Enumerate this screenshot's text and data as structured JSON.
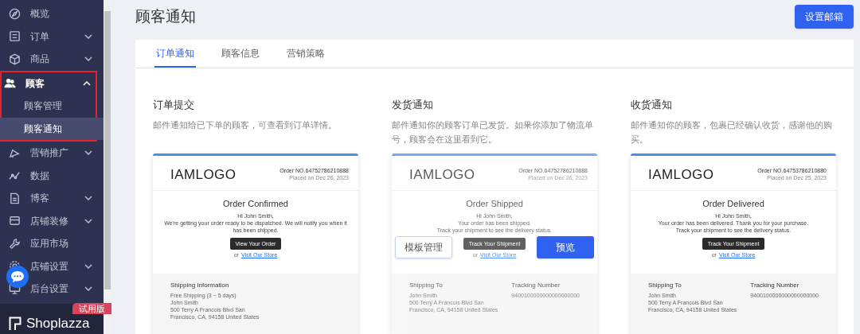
{
  "sidebar": {
    "items": [
      {
        "label": "概览",
        "expanded": false,
        "has_children": false,
        "highlighted": false
      },
      {
        "label": "订单",
        "expanded": false,
        "has_children": true,
        "highlighted": false
      },
      {
        "label": "商品",
        "expanded": false,
        "has_children": true,
        "highlighted": false
      },
      {
        "label": "顾客",
        "expanded": true,
        "has_children": true,
        "highlighted": true,
        "children": [
          {
            "label": "顾客管理",
            "selected": false
          },
          {
            "label": "顾客通知",
            "selected": true
          }
        ]
      },
      {
        "label": "营销推广",
        "expanded": false,
        "has_children": true,
        "highlighted": false
      },
      {
        "label": "数据",
        "expanded": false,
        "has_children": false,
        "highlighted": false
      },
      {
        "label": "博客",
        "expanded": false,
        "has_children": true,
        "highlighted": false
      },
      {
        "label": "店铺装修",
        "expanded": false,
        "has_children": true,
        "highlighted": false
      },
      {
        "label": "应用市场",
        "expanded": false,
        "has_children": false,
        "highlighted": false
      },
      {
        "label": "店铺设置",
        "expanded": false,
        "has_children": true,
        "highlighted": false
      },
      {
        "label": "后台设置",
        "expanded": false,
        "has_children": true,
        "highlighted": false
      }
    ],
    "trial_badge": "试用版",
    "brand": "Shoplazza"
  },
  "page": {
    "title": "顾客通知",
    "action_button": "设置邮箱"
  },
  "tabs": [
    {
      "label": "订单通知",
      "selected": true
    },
    {
      "label": "顾客信息",
      "selected": false
    },
    {
      "label": "营销策略",
      "selected": false
    }
  ],
  "notifications": [
    {
      "title": "订单提交",
      "description": "邮件通知给已下单的顾客，可查看到订单详情。",
      "hovered": false,
      "email": {
        "logo": "IAMLOGO",
        "order_no": "Order NO.64752786210888",
        "placed_on": "Placed on Dec 26, 2023",
        "heading": "Order Confirmed",
        "lines": [
          "Hi  John Smith,",
          "We're getting your order ready to be dispatched. We will notify you when it has been shipped."
        ],
        "button": "View Your Order",
        "or": "or",
        "link": "Visit Our Store",
        "footer": [
          {
            "heading": "Shipping Information",
            "lines": [
              "Free Shipping (3 ~ 5 days)",
              "John Smith",
              "500 Terry A Francois Blvd San",
              "Francisco, CA, 94158 United States"
            ]
          }
        ]
      }
    },
    {
      "title": "发货通知",
      "description": "邮件通知你的顾客订单已发货。如果你添加了物流单号，顾客会在这里看到它。",
      "hovered": true,
      "hover_buttons": [
        "模板管理",
        "预览"
      ],
      "email": {
        "logo": "IAMLOGO",
        "order_no": "Order NO.64752786210888",
        "placed_on": "Placed on Dec 26, 2023",
        "heading": "Order Shipped",
        "lines": [
          "Hi  John Smith,",
          "Your order has been shipped.",
          "Track your shipment to see the delivery status."
        ],
        "button": "Track Your Shipment",
        "or": "or",
        "link": "Visit Our Store",
        "footer": [
          {
            "heading": "Shipping To",
            "lines": [
              "John Smith",
              "500 Terry A Francois Blvd San",
              "Francisco, CA, 94158 United States"
            ]
          },
          {
            "heading": "Tracking Number",
            "lines": [
              "9400100000000000000000"
            ]
          }
        ]
      }
    },
    {
      "title": "收货通知",
      "description": "邮件通知你的顾客，包裹已经确认收货，感谢他的购买。",
      "hovered": false,
      "email": {
        "logo": "IAMLOGO",
        "order_no": "Order NO.64753786210880",
        "placed_on": "Placed on Dec 25, 2023",
        "heading": "Order Delivered",
        "lines": [
          "Hi  John Smith,",
          "Your order has been delivered. Thank you for your purchase.",
          "Track your shipment to see the delivery status."
        ],
        "button": "Track Your Shipment",
        "or": "or",
        "link": "Visit Our Store",
        "footer": [
          {
            "heading": "Shipping To",
            "lines": [
              "John Smith",
              "500 Terry A Francois Blvd San",
              "Francisco, CA, 94158 United States"
            ]
          },
          {
            "heading": "Tracking Number",
            "lines": [
              "9400100000000000000000"
            ]
          }
        ]
      }
    }
  ]
}
